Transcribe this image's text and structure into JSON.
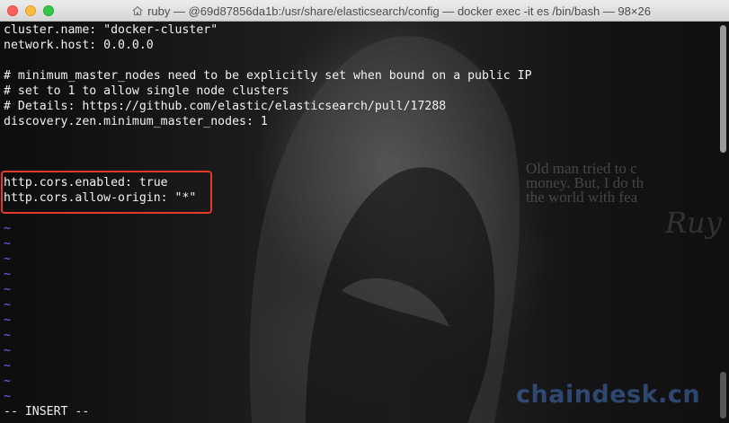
{
  "window": {
    "title": "ruby — @69d87856da1b:/usr/share/elasticsearch/config — docker exec -it es /bin/bash — 98×26"
  },
  "terminal": {
    "lines": [
      "cluster.name: \"docker-cluster\"",
      "network.host: 0.0.0.0",
      "",
      "# minimum_master_nodes need to be explicitly set when bound on a public IP",
      "# set to 1 to allow single node clusters",
      "# Details: https://github.com/elastic/elasticsearch/pull/17288",
      "discovery.zen.minimum_master_nodes: 1",
      "",
      "",
      "",
      "http.cors.enabled: true",
      "http.cors.allow-origin: \"*\"",
      "",
      "~",
      "~",
      "~",
      "~",
      "~",
      "~",
      "~",
      "~",
      "~",
      "~",
      "~",
      "~",
      "-- INSERT --"
    ]
  },
  "background": {
    "quote_lines": [
      "Old man tried to c",
      "money. But, I do th",
      "the world with fea"
    ],
    "signature": "Ruy"
  },
  "watermark": "chaindesk.cn",
  "colors": {
    "text": "#f2f2f2",
    "tilde": "#6b62ff",
    "highlight": "#e33a2a",
    "watermark": "#4673be"
  }
}
